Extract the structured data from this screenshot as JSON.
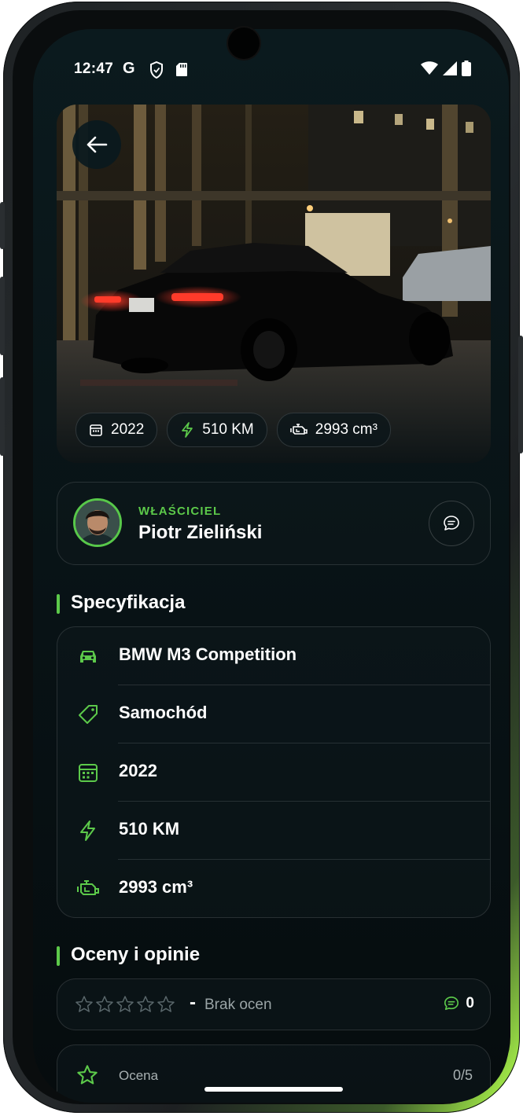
{
  "status_bar": {
    "time": "12:47"
  },
  "hero": {
    "chips": [
      {
        "icon": "calendar-icon",
        "label": "2022"
      },
      {
        "icon": "bolt-icon",
        "label": "510 KM"
      },
      {
        "icon": "engine-icon",
        "label": "2993 cm³"
      }
    ]
  },
  "owner": {
    "label": "WŁAŚCICIEL",
    "name": "Piotr Zieliński"
  },
  "specs": {
    "title": "Specyfikacja",
    "rows": [
      {
        "icon": "car-icon",
        "text": "BMW M3 Competition"
      },
      {
        "icon": "tag-icon",
        "text": "Samochód"
      },
      {
        "icon": "calendar-icon",
        "text": "2022"
      },
      {
        "icon": "bolt-icon",
        "text": "510 KM"
      },
      {
        "icon": "engine-icon",
        "text": "2993 cm³"
      }
    ]
  },
  "ratings": {
    "title": "Oceny i opinie",
    "dash": "-",
    "summary": "Brak ocen",
    "stars_filled": 0,
    "stars_total": 5,
    "comments_count": "0",
    "rate_label": "Ocena",
    "rate_value": "0/5"
  },
  "colors": {
    "accent": "#5cc94a",
    "background": "#08141a"
  }
}
